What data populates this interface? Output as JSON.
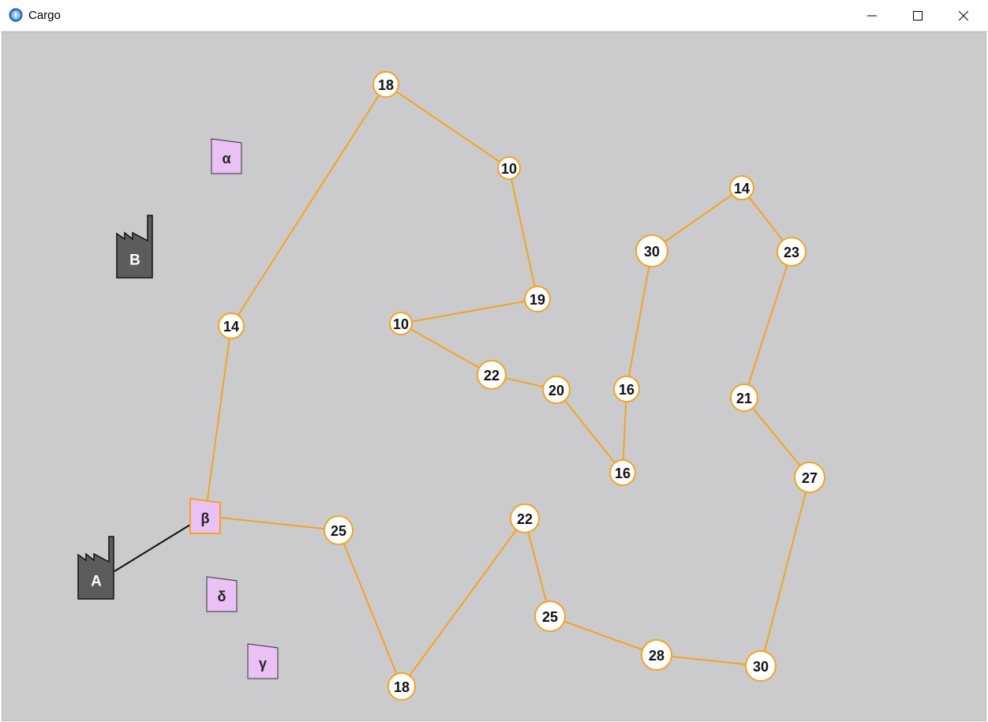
{
  "window": {
    "title": "Cargo",
    "app_icon": "compass-globe-icon",
    "controls": [
      "minimize-icon",
      "maximize-icon",
      "close-icon"
    ]
  },
  "colors": {
    "canvas": "#cbcbcd",
    "route": "#f4a321",
    "node_fill": "#ffffff",
    "station_fill": "#e9c1f5",
    "station_highlight_border": "#f4a321",
    "factory_fill": "#5b5d5d",
    "link": "#111111"
  },
  "factories": [
    {
      "id": "A",
      "label": "A"
    },
    {
      "id": "B",
      "label": "B"
    }
  ],
  "stations": [
    {
      "id": "alpha",
      "label": "α",
      "highlighted": false
    },
    {
      "id": "beta",
      "label": "β",
      "highlighted": true
    },
    {
      "id": "delta",
      "label": "δ",
      "highlighted": false
    },
    {
      "id": "gamma",
      "label": "γ",
      "highlighted": false
    }
  ],
  "nodes": [
    {
      "id": "n1",
      "value": "18"
    },
    {
      "id": "n2",
      "value": "10"
    },
    {
      "id": "n3",
      "value": "19"
    },
    {
      "id": "n4",
      "value": "10"
    },
    {
      "id": "n5",
      "value": "22"
    },
    {
      "id": "n6",
      "value": "20"
    },
    {
      "id": "n7",
      "value": "16"
    },
    {
      "id": "n8",
      "value": "16"
    },
    {
      "id": "n9",
      "value": "30"
    },
    {
      "id": "n10",
      "value": "14"
    },
    {
      "id": "n11",
      "value": "23"
    },
    {
      "id": "n12",
      "value": "21"
    },
    {
      "id": "n13",
      "value": "27"
    },
    {
      "id": "n14",
      "value": "30"
    },
    {
      "id": "n15",
      "value": "28"
    },
    {
      "id": "n16",
      "value": "25"
    },
    {
      "id": "n17",
      "value": "22"
    },
    {
      "id": "n18",
      "value": "18"
    },
    {
      "id": "n19",
      "value": "25"
    },
    {
      "id": "n20",
      "value": "14"
    }
  ],
  "route": [
    "beta",
    "n20",
    "n1",
    "n2",
    "n3",
    "n4",
    "n5",
    "n6",
    "n7",
    "n8",
    "n9",
    "n10",
    "n11",
    "n12",
    "n13",
    "n14",
    "n15",
    "n16",
    "n17",
    "n18",
    "n19",
    "beta"
  ],
  "links": [
    [
      "A",
      "beta"
    ]
  ]
}
